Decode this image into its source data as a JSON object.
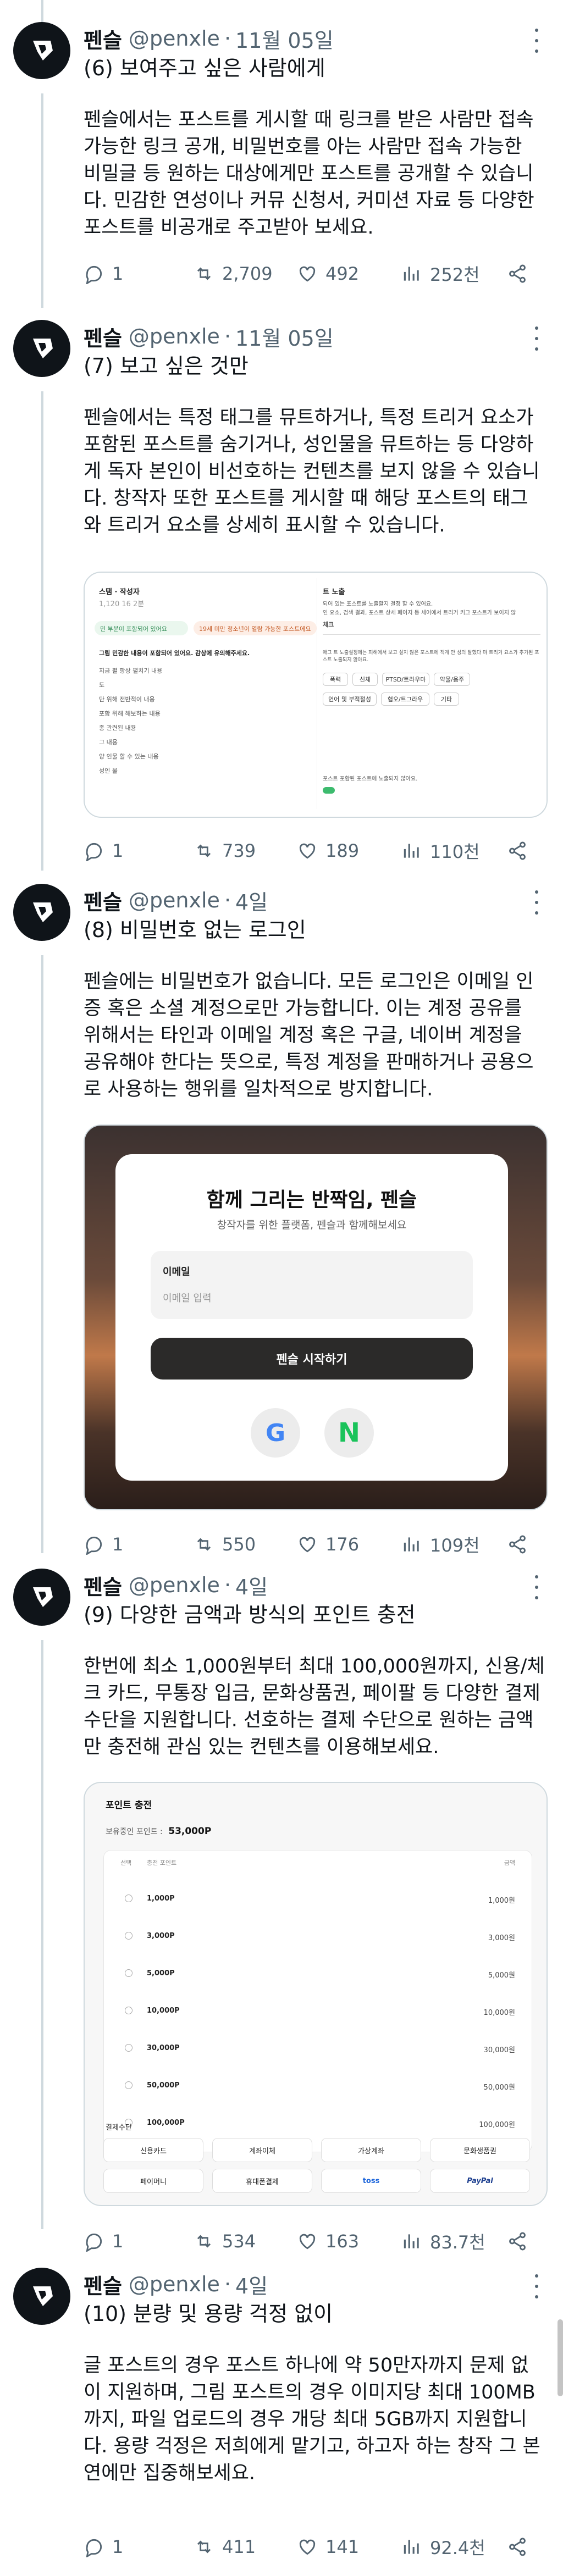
{
  "colors": {
    "text": "#0f1419",
    "secondary": "#536471",
    "border": "#cfd9de",
    "avatar_bg": "#0f1419"
  },
  "icons": {
    "reply": "reply-bubble-icon",
    "repost": "repost-arrows-icon",
    "like": "heart-icon",
    "views": "bar-chart-icon",
    "share": "share-icon",
    "more": "more-dots-icon"
  },
  "posts": [
    {
      "name": "펜슬",
      "handle": "@penxle",
      "sep": "·",
      "date": "11월 05일",
      "title": "(6) 보여주고 싶은 사람에게",
      "body": "펜슬에서는 포스트를 게시할 때 링크를 받은 사람만 접속 가능한 링크 공개, 비밀번호를 아는 사람만 접속 가능한 비밀글 등 원하는 대상에게만 포스트를 공개할 수 있습니다. 민감한 연성이나 커뮤 신청서, 커미션 자료 등 다양한 포스트를 비공개로 주고받아 보세요.",
      "replies": "1",
      "reposts": "2,709",
      "likes": "492",
      "views": "252천"
    },
    {
      "name": "펜슬",
      "handle": "@penxle",
      "sep": "·",
      "date": "11월 05일",
      "title": "(7) 보고 싶은 것만",
      "body": "펜슬에서는 특정 태그를 뮤트하거나, 특정 트리거 요소가 포함된 포스트를 숨기거나, 성인물을 뮤트하는 등 다양하게 독자 본인이 비선호하는 컨텐츠를 보지 않을 수 있습니다. 창작자 또한 포스트를 게시할 때 해당 포스트의 태그와 트리거 요소를 상세히 표시할 수 있습니다.",
      "replies": "1",
      "reposts": "739",
      "likes": "189",
      "views": "110천"
    },
    {
      "name": "펜슬",
      "handle": "@penxle",
      "sep": "·",
      "date": "4일",
      "title": "(8) 비밀번호 없는 로그인",
      "body": "펜슬에는 비밀번호가 없습니다. 모든 로그인은 이메일 인증 혹은 소셜 계정으로만 가능합니다. 이는 계정 공유를 위해서는 타인과 이메일 계정 혹은 구글, 네이버 계정을 공유해야 한다는 뜻으로, 특정 계정을 판매하거나 공용으로 사용하는 행위를 일차적으로 방지합니다.",
      "replies": "1",
      "reposts": "550",
      "likes": "176",
      "views": "109천"
    },
    {
      "name": "펜슬",
      "handle": "@penxle",
      "sep": "·",
      "date": "4일",
      "title": "(9) 다양한 금액과 방식의 포인트 충전",
      "body": "한번에 최소 1,000원부터 최대 100,000원까지, 신용/체크 카드, 무통장 입금, 문화상품권, 페이팔 등 다양한 결제 수단을 지원합니다. 선호하는 결제 수단으로 원하는 금액만 충전해 관심 있는 컨텐츠를 이용해보세요.",
      "replies": "1",
      "reposts": "534",
      "likes": "163",
      "views": "83.7천"
    },
    {
      "name": "펜슬",
      "handle": "@penxle",
      "sep": "·",
      "date": "4일",
      "title": "(10) 분량 및 용량 걱정 없이",
      "body": "글 포스트의 경우 포스트 하나에 약 50만자까지 문제 없이 지원하며, 그림 포스트의 경우 이미지당 최대 100MB까지, 파일 업로드의 경우 개당 최대 5GB까지 지원합니다. 용량 걱정은 저희에게 맡기고, 하고자 하는 창작 그 본연에만 집중해보세요.",
      "replies": "1",
      "reposts": "411",
      "likes": "141",
      "views": "92.4천"
    }
  ],
  "media_mute": {
    "left_header": "스탬 · 작성자",
    "left_meta": "1,120  16  2분",
    "left_notice_a": "민 부분이 포함되어 있어요",
    "left_notice_b": "19세 미만 청소년이 열람 가능한 포스트에요",
    "left_heading": "그림 민감한 내용이 포함되어 있어요. 감상에 유의해주세요.",
    "left_list": [
      "지금 펼 항상 펼치기 내용",
      "도",
      "단 위해 전반적이 내용",
      "포함 위해 해보하는 내용",
      "종 관련된 내용",
      "그 내용",
      "양 인물 할 수 있는 내용",
      "성인 물"
    ],
    "right_header": "트 노출",
    "right_desc_a": "되어 있는 포스트를 노출할지 결정 할 수 있어요.",
    "right_desc_b": "인 요소, 검색 결과, 포스트 상세 페이지 등 세어에서 트리거 키그 포스트가 보이지 않",
    "right_tab": "체크",
    "right_small": "애그 트 노출설정에는 피해에서 보고 싶지 않은 포스트에 적게 만 성의 달했다 마 트리거 요소가 추가된 포스트 노출되지 않아요.",
    "chips": [
      "폭력",
      "신체",
      "PTSD/트라우마",
      "약물/음주",
      "언어 및 부적절성",
      "혐오/트그라우",
      "기타"
    ],
    "footer": "포스트 포함된 포스트에 노출되지 않아요."
  },
  "media_login": {
    "title": "함께 그리는 반짝임, 펜슬",
    "subtitle": "창작자를 위한 플랫폼, 펜슬과 함께해보세요",
    "email_label": "이메일",
    "email_placeholder": "이메일 입력",
    "start_button": "펜슬 시작하기",
    "google_letter": "G",
    "naver_letter": "N"
  },
  "media_points": {
    "title": "포인트 충전",
    "balance_label": "보유중인 포인트 :",
    "balance_value": "53,000P",
    "col_select": "선택",
    "col_amount": "충전 포인트",
    "col_price": "금액",
    "rows": [
      {
        "amount": "1,000P",
        "price": "1,000원"
      },
      {
        "amount": "3,000P",
        "price": "3,000원"
      },
      {
        "amount": "5,000P",
        "price": "5,000원"
      },
      {
        "amount": "10,000P",
        "price": "10,000원"
      },
      {
        "amount": "30,000P",
        "price": "30,000원"
      },
      {
        "amount": "50,000P",
        "price": "50,000원"
      },
      {
        "amount": "100,000P",
        "price": "100,000원"
      }
    ],
    "methods_label": "결제수단",
    "methods": [
      "신용카드",
      "계좌이체",
      "가상계좌",
      "문화생품권",
      "페이머니",
      "휴대폰결제",
      "toss",
      "PayPal"
    ]
  }
}
